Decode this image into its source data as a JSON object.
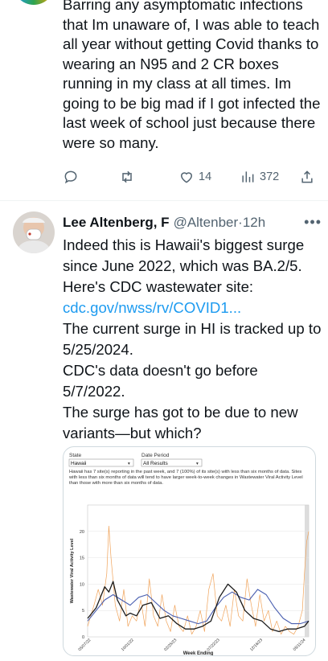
{
  "tweet1": {
    "text": "Barring any asymptomatic infections that Im unaware of, I was able to teach all year without getting Covid thanks to wearing an N95 and 2 CR boxes running in my class at all times. Im going to be big mad if I got infected the last week of school just because there were so many.",
    "actions": {
      "reply_count": "",
      "retweet_count": "",
      "like_count": "14",
      "view_count": "372"
    }
  },
  "tweet2": {
    "author": "Lee Altenberg, F",
    "handle": "@Altenber·",
    "time": "12h",
    "text_part1": "Indeed this is Hawaii's biggest surge since June 2022, which was BA.2/5. Here's CDC wastewater site: ",
    "link": "cdc.gov/nwss/rv/COVID1...",
    "text_part2": "The current surge in HI is tracked up to 5/25/2024.",
    "text_part3": "CDC's data doesn't go before 5/7/2022.",
    "text_part4": "The surge has got to be due to new variants—but which?",
    "card": {
      "state_label": "State",
      "state_value": "Hawaii",
      "period_label": "Date Period",
      "period_value": "All Results",
      "note": "Hawaii has 7 site(s) reporting in the past week, and 7 (100%) of its site(s) with less than six months of data. Sites with less than six months of data will tend to have larger week-to-week changes in Wastewater Viral Activity Level than those with more than six months of data."
    }
  },
  "chart_data": {
    "type": "line",
    "title": "",
    "xlabel": "Week Ending",
    "ylabel": "Wastewater Viral Activity Level",
    "ylim": [
      0,
      25
    ],
    "yticks": [
      "0",
      "5",
      "10",
      "15",
      "20"
    ],
    "xticks": [
      "05/07/22",
      "10/01/22",
      "02/25/23",
      "07/22/23",
      "12/16/23",
      "05/11/24"
    ],
    "grid": true,
    "colors": {
      "state": "#1b1b1b",
      "national": "#4a5fb0",
      "site": "#f0a35a"
    },
    "series": [
      {
        "x": [
          0,
          4,
          8,
          10,
          12,
          14,
          16,
          18,
          20,
          23,
          26,
          30,
          34,
          38,
          42,
          46,
          50,
          54,
          58,
          62,
          66,
          70,
          74,
          78,
          82,
          86,
          90,
          94,
          98,
          102,
          104
        ],
        "values": [
          3.5,
          5.5,
          9.5,
          8.5,
          10.5,
          7,
          5.5,
          4,
          4.5,
          4,
          6,
          6.5,
          3.5,
          4,
          2.5,
          1.5,
          1.5,
          2,
          3,
          7.5,
          10,
          8.5,
          5,
          3.5,
          3,
          1.5,
          1,
          1.5,
          1.5,
          2,
          3
        ]
      },
      {
        "x": [
          0,
          4,
          8,
          12,
          16,
          20,
          24,
          28,
          32,
          36,
          40,
          44,
          48,
          52,
          56,
          60,
          64,
          68,
          72,
          76,
          80,
          84,
          88,
          92,
          96,
          100,
          104
        ],
        "values": [
          3,
          5,
          7,
          8,
          7,
          6,
          7.5,
          8,
          6.5,
          5,
          4,
          3.5,
          3,
          2.5,
          3,
          5.5,
          7.5,
          8.5,
          7.5,
          7,
          9,
          8,
          5.5,
          3.5,
          2.5,
          2.5,
          3
        ]
      },
      {
        "x": [
          0,
          3,
          5,
          7,
          9,
          10,
          11,
          13,
          15,
          17,
          19,
          21,
          23,
          25,
          27,
          29,
          31,
          33,
          35,
          37,
          39,
          41,
          43,
          45,
          47,
          49,
          51,
          53,
          55,
          57,
          59,
          61,
          63,
          65,
          67,
          69,
          71,
          73,
          75,
          77,
          79,
          81,
          83,
          85,
          87,
          89,
          91,
          93,
          95,
          97,
          99,
          101,
          102,
          103,
          104
        ],
        "values": [
          2,
          6,
          9,
          6,
          12,
          21,
          15,
          6,
          3,
          9,
          2,
          4,
          3,
          7,
          2,
          11,
          4,
          2,
          8,
          3,
          1,
          6,
          2,
          1,
          4,
          0.5,
          2,
          5,
          1,
          9,
          12,
          4,
          3,
          6,
          2,
          9,
          4,
          3,
          11,
          6,
          2,
          8,
          3,
          5,
          1,
          3,
          0.5,
          2,
          1,
          0.5,
          2,
          5,
          12,
          18,
          20
        ]
      }
    ]
  }
}
